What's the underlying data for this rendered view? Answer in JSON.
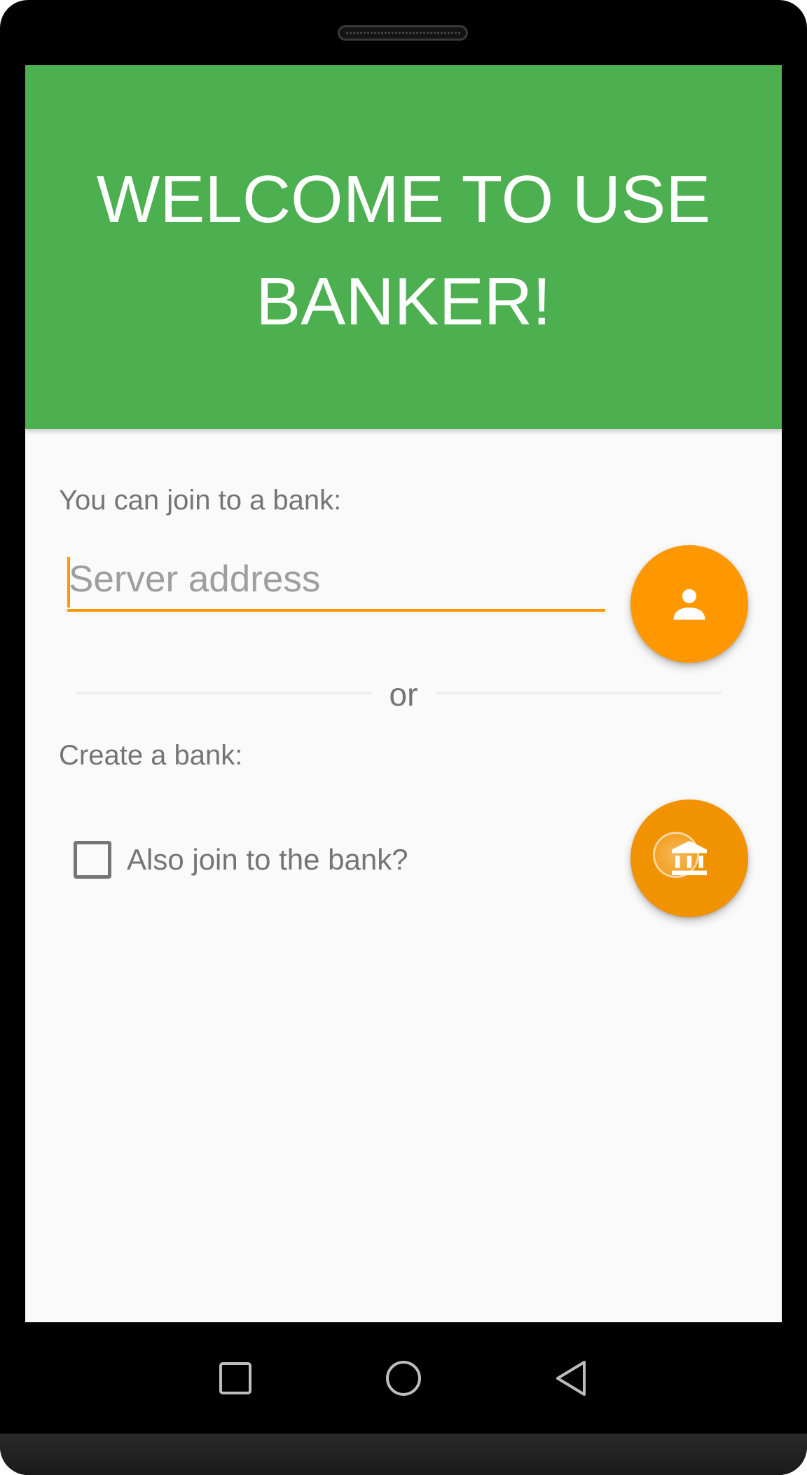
{
  "header": {
    "title": "WELCOME TO USE BANKER!"
  },
  "join_section": {
    "label": "You can join to a bank:",
    "server_field": {
      "placeholder": "Server address",
      "value": ""
    },
    "join_button_icon": "person-icon"
  },
  "divider": {
    "text": "or"
  },
  "create_section": {
    "label": "Create a bank:",
    "also_join_checkbox": {
      "label": "Also join to the bank?",
      "checked": false
    },
    "create_button_icon": "bank-icon"
  },
  "nav_bar": {
    "icons": [
      "recents-icon",
      "home-icon",
      "back-icon"
    ]
  },
  "colors": {
    "header": "#4caf50",
    "accent": "#ff9800",
    "background": "#fafafa",
    "text_secondary": "#757575"
  }
}
